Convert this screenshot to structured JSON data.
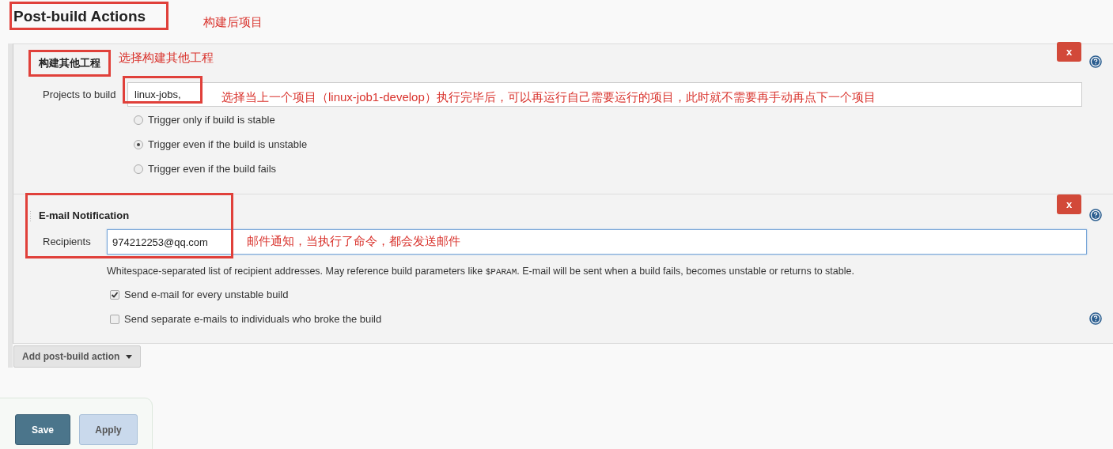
{
  "title": "Post-build Actions",
  "annotations": [
    {
      "text": "构建后项目"
    },
    {
      "text": "选择构建其他工程"
    },
    {
      "text": "选择当上一个项目（linux-job1-develop）执行完毕后，可以再运行自己需要运行的项目，此时就不需要再手动再点下一个项目"
    },
    {
      "text": "邮件通知，当执行了命令，都会发送邮件"
    }
  ],
  "build_other": {
    "header": "构建其他工程",
    "delete": "x",
    "field_label": "Projects to build",
    "value": "linux-jobs,",
    "options": [
      {
        "label": "Trigger only if build is stable",
        "selected": false
      },
      {
        "label": "Trigger even if the build is unstable",
        "selected": true
      },
      {
        "label": "Trigger even if the build fails",
        "selected": false
      }
    ]
  },
  "email": {
    "header": "E-mail Notification",
    "delete": "x",
    "field_label": "Recipients",
    "value": "974212253@qq.com",
    "focused": true,
    "help": {
      "before": "Whitespace-separated list of recipient addresses. May reference build parameters like ",
      "code": "$PARAM",
      "after": ". E-mail will be sent when a build fails, becomes unstable or returns to stable."
    },
    "checks": [
      {
        "label": "Send e-mail for every unstable build",
        "checked": true
      },
      {
        "label": "Send separate e-mails to individuals who broke the build",
        "checked": false
      }
    ]
  },
  "add_button": "Add post-build action",
  "buttons": [
    {
      "label": "Save",
      "kind": "primary"
    },
    {
      "label": "Apply",
      "kind": "secondary"
    }
  ]
}
